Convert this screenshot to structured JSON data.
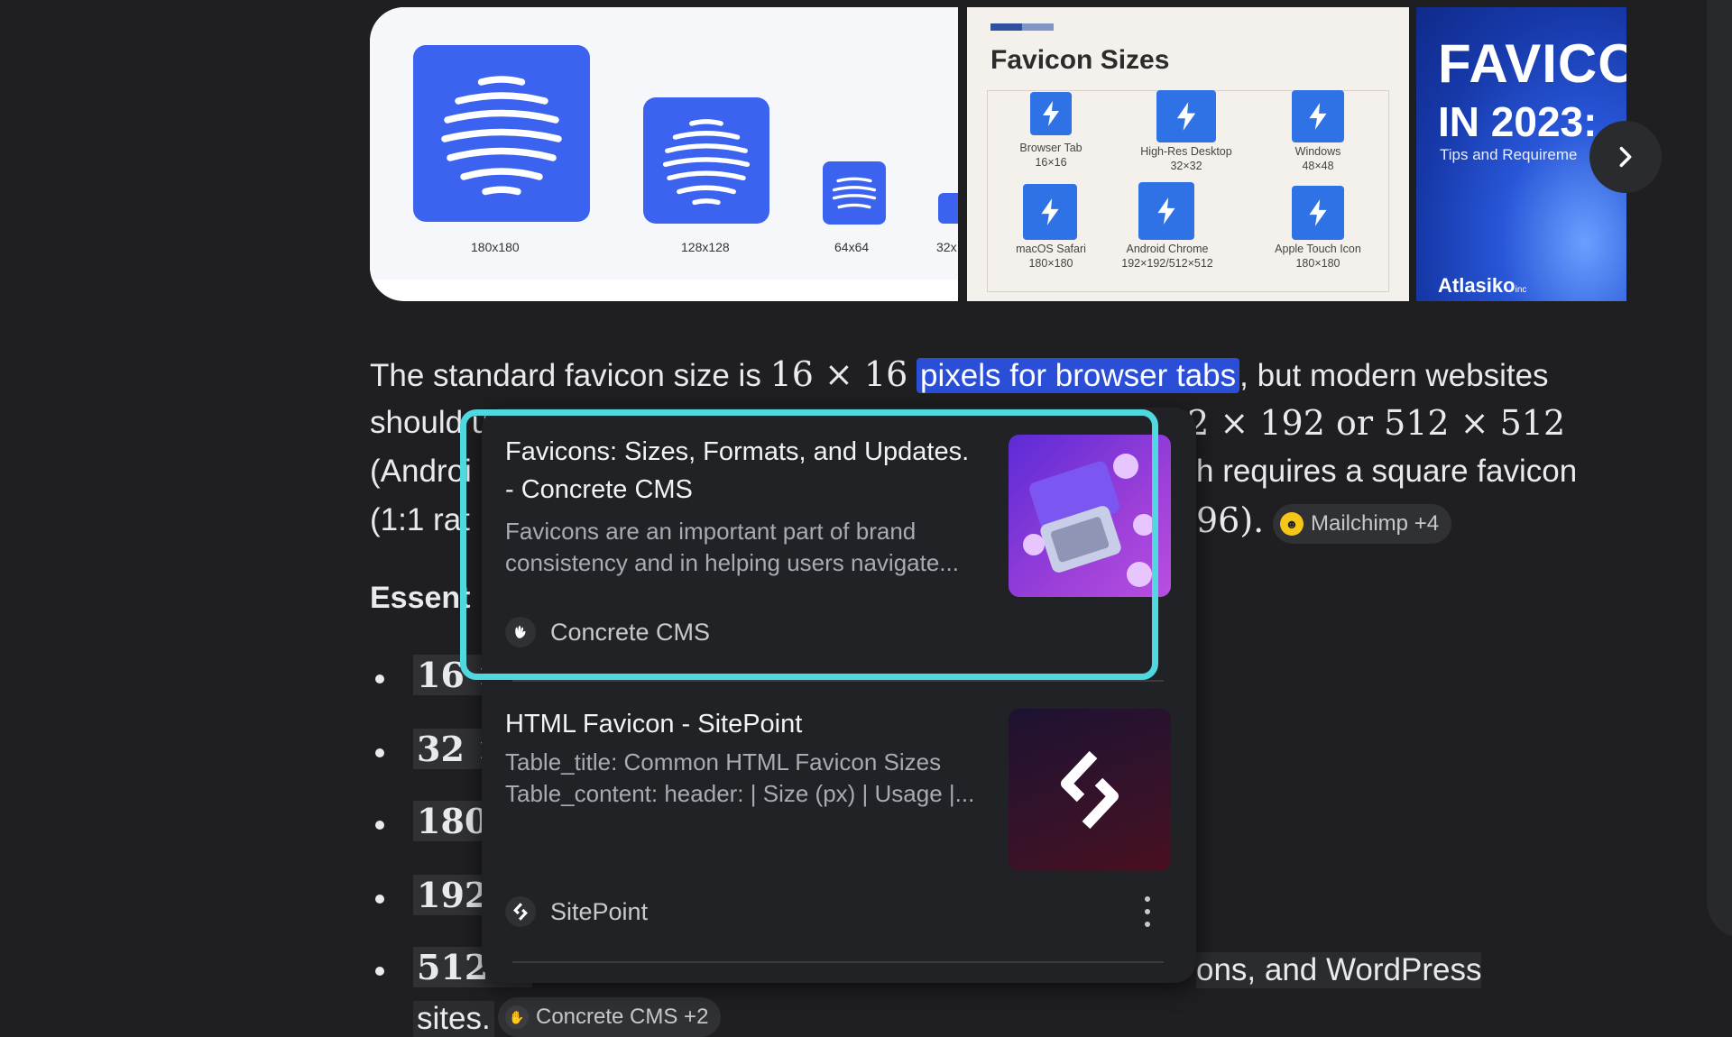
{
  "images": {
    "card1": {
      "sizes": [
        "180x180",
        "128x128",
        "64x64",
        "32x"
      ]
    },
    "card2": {
      "title": "Favicon Sizes",
      "tiles": [
        {
          "name": "Browser Tab",
          "size": "16×16"
        },
        {
          "name": "High-Res Desktop",
          "size": "32×32"
        },
        {
          "name": "Windows",
          "size": "48×48"
        },
        {
          "name": "macOS Safari",
          "size": "180×180"
        },
        {
          "name": "Android Chrome",
          "size": "192×192/512×512"
        },
        {
          "name": "Apple Touch Icon",
          "size": "180×180"
        }
      ]
    },
    "card3": {
      "line1": "FAVICO",
      "line2": "IN 2023:",
      "line3": "Tips and Requireme",
      "brand": "Atlasiko",
      "brand_suffix": "inc"
    },
    "next_icon": "chevron-right-icon"
  },
  "body": {
    "line1_a": "The standard favicon size is ",
    "line1_math": "16 × 16",
    "line1_hl": "pixels for browser tabs",
    "line1_b": ", but modern websites",
    "line2_a": "should u",
    "line2_math": "92 × 192 or 512 × 512",
    "line3_a": "(Androi",
    "line3_b": "h requires a square favicon",
    "line4_a": "(1:1 rat",
    "line4_b": "96).",
    "chip1": "Mailchimp +4",
    "heading": "Essent",
    "bullets": [
      "16 ×",
      "32 ×",
      "180 :",
      "192 :",
      "512 ×"
    ],
    "last_line_tail": "ons, and WordPress",
    "sites": "sites.",
    "chip2": "Concrete CMS +2"
  },
  "popup": {
    "results": [
      {
        "title": "Favicons: Sizes, Formats, and Updates. - Concrete CMS",
        "desc": "Favicons are an important part of brand consistency and in helping users navigate...",
        "source": "Concrete CMS"
      },
      {
        "title": "HTML Favicon - SitePoint",
        "desc": "Table_title: Common HTML Favicon Sizes Table_content: header: | Size (px) | Usage |...",
        "source": "SitePoint"
      }
    ]
  },
  "colors": {
    "highlight": "#2a4ed6",
    "focus_ring": "#4fd8e0",
    "bg": "#1f1f22"
  }
}
